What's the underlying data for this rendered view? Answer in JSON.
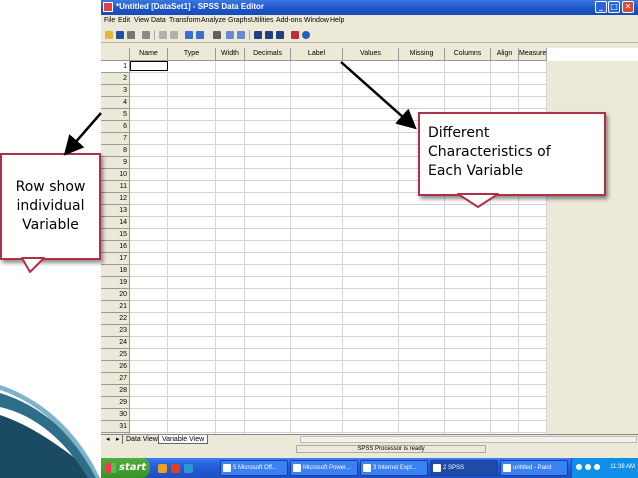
{
  "window": {
    "title": "*Untitled [DataSet1] - SPSS Data Editor",
    "minimize_glyph": "_",
    "maximize_glyph": "□",
    "close_glyph": "✕"
  },
  "menu": [
    "File",
    "Edit",
    "View",
    "Data",
    "Transform",
    "Analyze",
    "Graphs",
    "Utilities",
    "Add-ons",
    "Window",
    "Help"
  ],
  "toolbar_icons": [
    "open-icon",
    "save-icon",
    "print-icon",
    "dialog-recall-icon",
    "undo-icon",
    "redo-icon",
    "goto-case-icon",
    "variables-icon",
    "find-icon",
    "insert-cases-icon",
    "insert-variable-icon",
    "split-file-icon",
    "weight-cases-icon",
    "select-cases-icon",
    "value-labels-icon",
    "use-sets-icon"
  ],
  "columns": [
    "Name",
    "Type",
    "Width",
    "Decimals",
    "Label",
    "Values",
    "Missing",
    "Columns",
    "Align",
    "Measure"
  ],
  "rows": [
    "1",
    "2",
    "3",
    "4",
    "5",
    "6",
    "7",
    "8",
    "9",
    "10",
    "11",
    "12",
    "13",
    "14",
    "15",
    "16",
    "17",
    "18",
    "19",
    "20",
    "21",
    "22",
    "23",
    "24",
    "25",
    "26",
    "27",
    "28",
    "29",
    "30",
    "31",
    "32"
  ],
  "tabs": {
    "nav_first": "◂",
    "nav_last": "▸",
    "data_view": "Data View",
    "variable_view": "Variable View"
  },
  "status": {
    "processor": "SPSS Processor is ready"
  },
  "taskbar": {
    "start": "start",
    "tasks": [
      "5 Microsoft Off...",
      "Microsoft Power...",
      "3 Internet Expl...",
      "2 SPSS",
      "untitled - Paint"
    ],
    "clock": "11:38 AM"
  },
  "callouts": {
    "left": [
      "Row show",
      "individual",
      "Variable"
    ],
    "right": [
      "Different",
      "Characteristics of",
      "Each Variable"
    ]
  },
  "colors": {
    "callout_border": "#b03048",
    "titlebar": "#1c53c8",
    "taskbar": "#245edb"
  }
}
